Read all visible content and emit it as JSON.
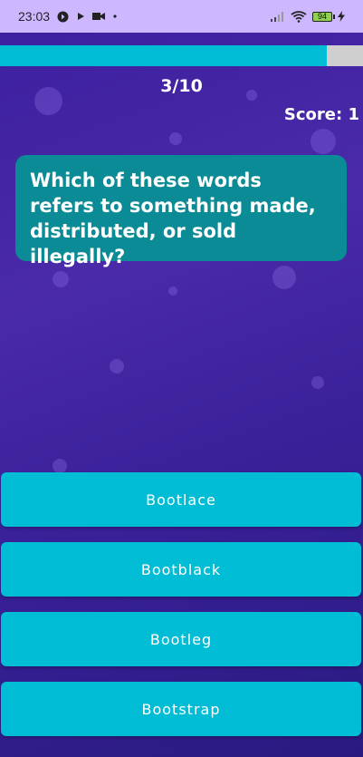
{
  "status_bar": {
    "time": "23:03",
    "battery_level": "94",
    "icons": [
      "brand-icon",
      "play-icon",
      "video-icon",
      "dot-icon",
      "signal-icon",
      "wifi-icon",
      "battery-icon",
      "charging-icon"
    ]
  },
  "quiz": {
    "progress_fraction": 0.9,
    "counter": "3/10",
    "score": "Score: 1",
    "question": "Which of these words refers to something made, distributed, or sold illegally?",
    "answers": [
      "Bootlace",
      "Bootblack",
      "Bootleg",
      "Bootstrap"
    ]
  },
  "colors": {
    "accent": "#00bcd4",
    "question_card": "#0a8b96",
    "background": "#3b1f9e",
    "status_bar": "#cdb8ff"
  }
}
